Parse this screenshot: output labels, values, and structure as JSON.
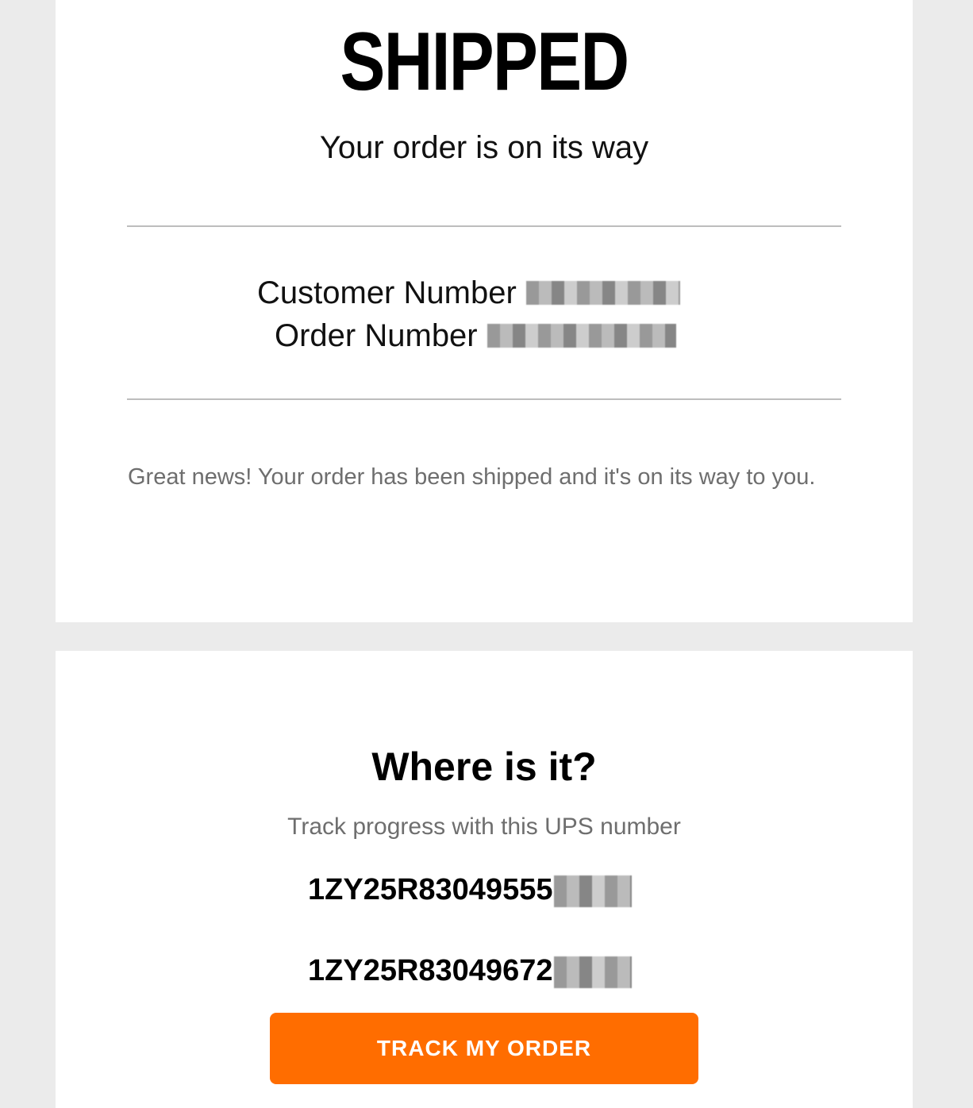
{
  "header": {
    "headline": "SHIPPED",
    "subheadline": "Your order is on its way"
  },
  "order_info": {
    "customer_number_label": "Customer Number",
    "order_number_label": "Order Number"
  },
  "message": "Great news! Your order has been shipped and it's on its way to you.",
  "tracking": {
    "title": "Where is it?",
    "caption": "Track progress with this UPS number",
    "numbers": [
      "1ZY25R83049555",
      "1ZY25R83049672"
    ],
    "button_label": "TRACK MY ORDER"
  },
  "colors": {
    "accent": "#ff6d00",
    "page_background": "#ebebeb",
    "card_background": "#ffffff",
    "muted_text": "#6e6e6e",
    "divider": "#bdbdbd"
  }
}
